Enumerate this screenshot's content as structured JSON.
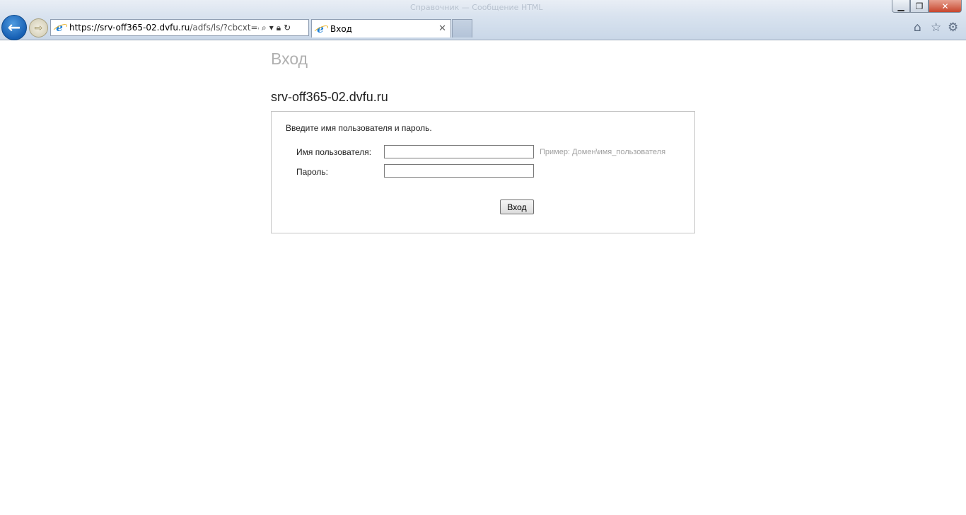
{
  "browser": {
    "window_title": "Справочник — Сообщение HTML",
    "url_host": "https://srv-off365-02.dvfu.ru",
    "url_path": "/adfs/ls/?cbcxt=&pop",
    "tab_title": "Вход"
  },
  "page": {
    "heading": "Вход",
    "server_name": "srv-off365-02.dvfu.ru",
    "instructions": "Введите имя пользователя и пароль.",
    "username_label": "Имя пользователя:",
    "username_value": "",
    "username_hint": "Пример: Домен\\имя_пользователя",
    "password_label": "Пароль:",
    "password_value": "",
    "submit_label": "Вход"
  },
  "colors": {
    "heading": "#b0b0b0",
    "hint": "#a0a0a0",
    "back_button": "#1f6fc4",
    "close_button": "#c7462d"
  },
  "icons": {
    "back": "back-arrow-icon",
    "forward": "forward-arrow-icon",
    "search": "search-icon",
    "lock": "lock-icon",
    "refresh": "refresh-icon",
    "home": "home-icon",
    "favorites": "star-icon",
    "tools": "gear-icon"
  }
}
